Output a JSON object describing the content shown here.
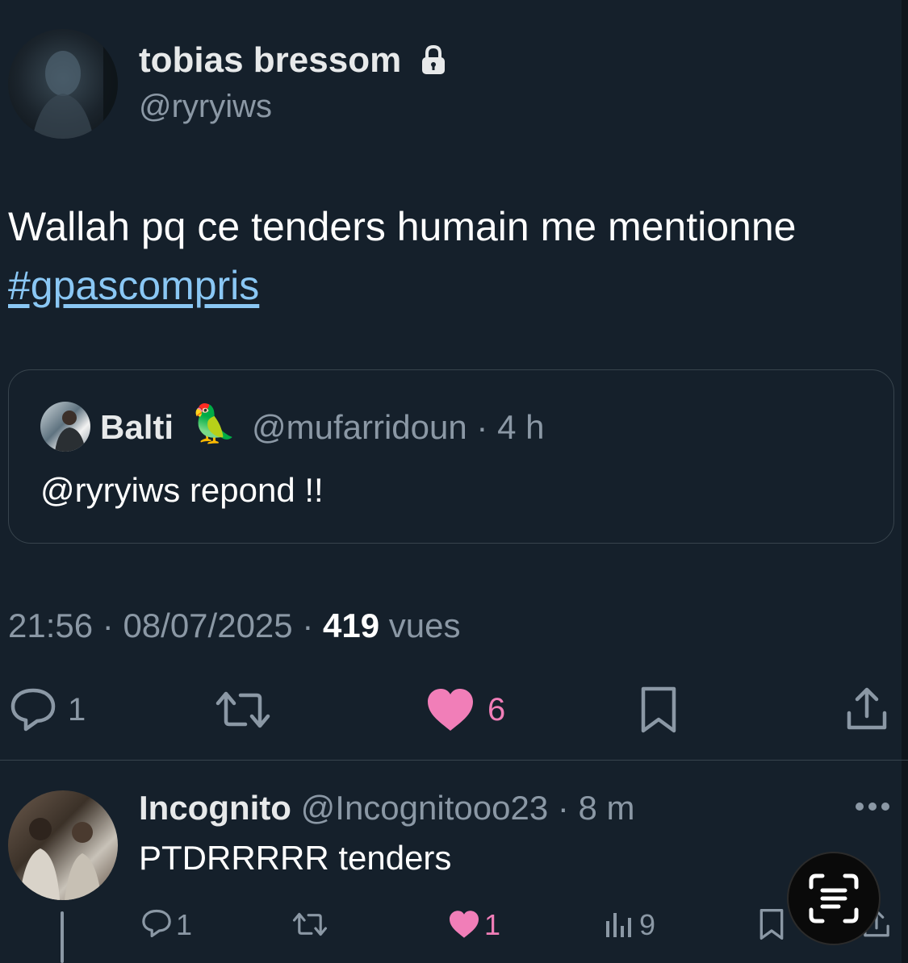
{
  "tweet": {
    "author_name": "tobias bressom",
    "author_handle": "@ryryiws",
    "text": "Wallah pq ce tenders humain me mentionne",
    "hashtag": "#gpascompris",
    "time": "21:56",
    "date": "08/07/2025",
    "views_count": "419",
    "views_label": "vues",
    "replies": "1",
    "likes": "6"
  },
  "quoted": {
    "name": "Balti",
    "emoji": "🦜",
    "handle": "@mufarridoun",
    "age": "4 h",
    "text": "@ryryiws repond !!"
  },
  "reply": {
    "name": "Incognito",
    "handle": "@Incognitooo23",
    "age": "8 m",
    "text": "PTDRRRRR tenders",
    "replies": "1",
    "likes": "1",
    "views": "9"
  },
  "colors": {
    "background": "#15202b",
    "muted": "#8b98a5",
    "link": "#8ac7f4",
    "like": "#f17eb8"
  },
  "icons": [
    "lock-icon",
    "reply-icon",
    "retweet-icon",
    "heart-icon",
    "bookmark-icon",
    "share-icon",
    "more-icon",
    "views-icon",
    "scan-text-icon"
  ]
}
